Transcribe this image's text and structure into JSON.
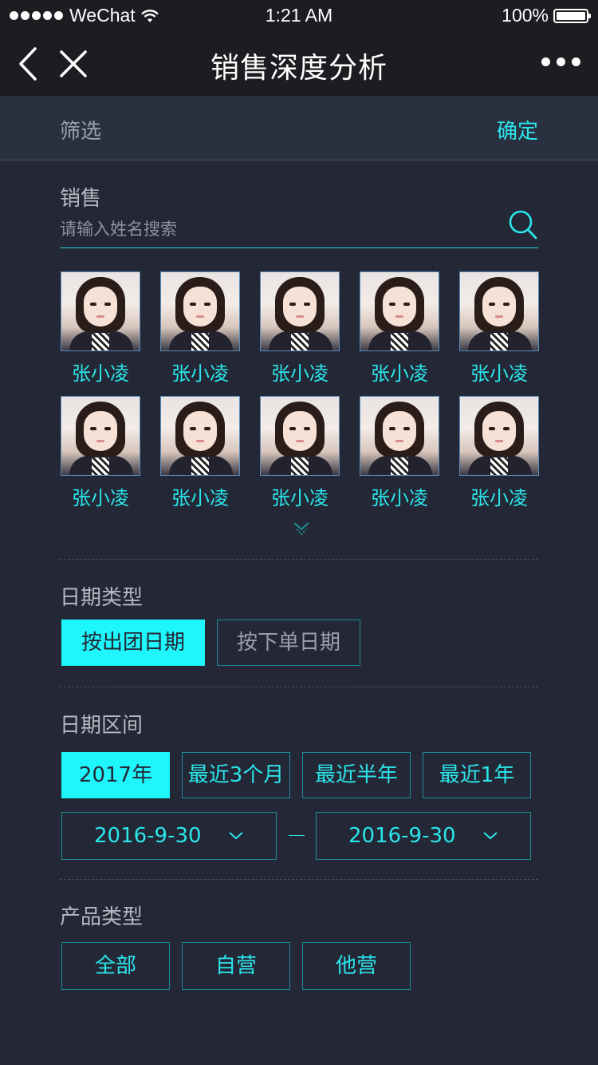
{
  "status_bar": {
    "carrier": "WeChat",
    "time": "1:21 AM",
    "battery": "100%"
  },
  "nav": {
    "title": "销售深度分析"
  },
  "filter": {
    "title": "筛选",
    "confirm": "确定"
  },
  "sales": {
    "label": "销售",
    "search_placeholder": "请输入姓名搜索",
    "people": [
      {
        "name": "张小凌"
      },
      {
        "name": "张小凌"
      },
      {
        "name": "张小凌"
      },
      {
        "name": "张小凌"
      },
      {
        "name": "张小凌"
      },
      {
        "name": "张小凌"
      },
      {
        "name": "张小凌"
      },
      {
        "name": "张小凌"
      },
      {
        "name": "张小凌"
      },
      {
        "name": "张小凌"
      }
    ]
  },
  "date_type": {
    "label": "日期类型",
    "options": [
      "按出团日期",
      "按下单日期"
    ],
    "selected": "按出团日期"
  },
  "date_range": {
    "label": "日期区间",
    "options": [
      "2017年",
      "最近3个月",
      "最近半年",
      "最近1年"
    ],
    "selected": "2017年",
    "start": "2016-9-30",
    "end": "2016-9-30"
  },
  "product_type": {
    "label": "产品类型",
    "options": [
      "全部",
      "自营",
      "他营"
    ]
  },
  "colors": {
    "accent": "#1ef6fb",
    "background": "#232736",
    "bar": "#1b1d21"
  }
}
